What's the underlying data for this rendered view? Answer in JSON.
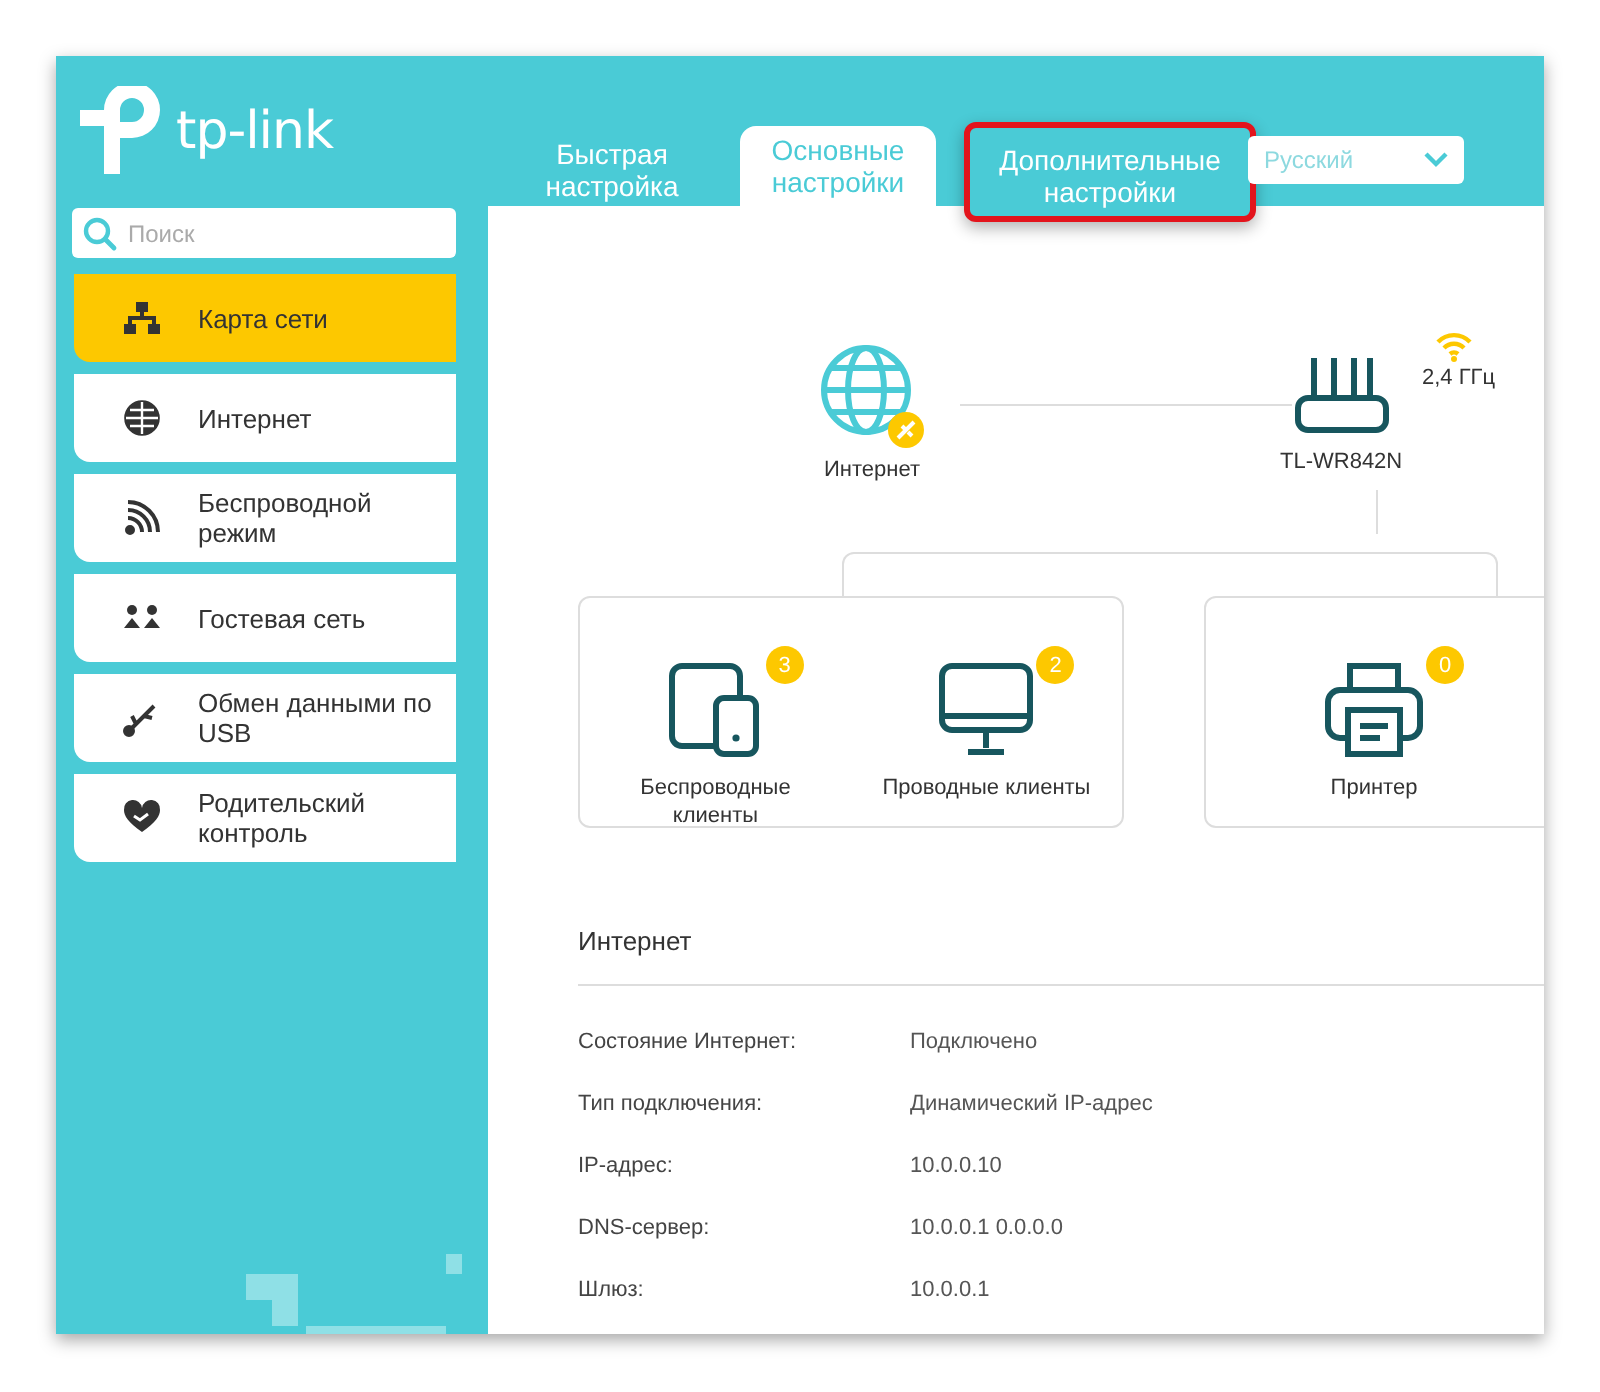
{
  "logo": {
    "text": "tp-link"
  },
  "tabs": [
    {
      "label": "Быстрая настройка",
      "selected": false,
      "highlighted": false
    },
    {
      "label": "Основные настройки",
      "selected": true,
      "highlighted": false
    },
    {
      "label": "Дополнительные настройки",
      "selected": false,
      "highlighted": true
    }
  ],
  "language": {
    "value": "Русский"
  },
  "search": {
    "placeholder": "Поиск"
  },
  "sidebar": {
    "items": [
      {
        "label": "Карта сети",
        "selected": true
      },
      {
        "label": "Интернет",
        "selected": false
      },
      {
        "label": "Беспроводной режим",
        "selected": false
      },
      {
        "label": "Гостевая сеть",
        "selected": false
      },
      {
        "label": "Обмен данными по USB",
        "selected": false
      },
      {
        "label": "Родительский контроль",
        "selected": false
      }
    ]
  },
  "network_map": {
    "internet": {
      "label": "Интернет"
    },
    "router": {
      "label": "TL-WR842N",
      "band": "2,4 ГГц"
    },
    "clients": [
      {
        "kind": "wireless",
        "label": "Беспроводные клиенты",
        "count": "3"
      },
      {
        "kind": "wired",
        "label": "Проводные клиенты",
        "count": "2"
      }
    ],
    "printer": {
      "label": "Принтер",
      "count": "0"
    }
  },
  "internet_info": {
    "title": "Интернет",
    "rows": [
      {
        "label": "Состояние Интернет:",
        "value": "Подключено"
      },
      {
        "label": "Тип подключения:",
        "value": "Динамический IP-адрес"
      },
      {
        "label": "IP-адрес:",
        "value": "10.0.0.10"
      },
      {
        "label": "DNS-сервер:",
        "value": "10.0.0.1 0.0.0.0"
      },
      {
        "label": "Шлюз:",
        "value": "10.0.0.1"
      }
    ]
  }
}
